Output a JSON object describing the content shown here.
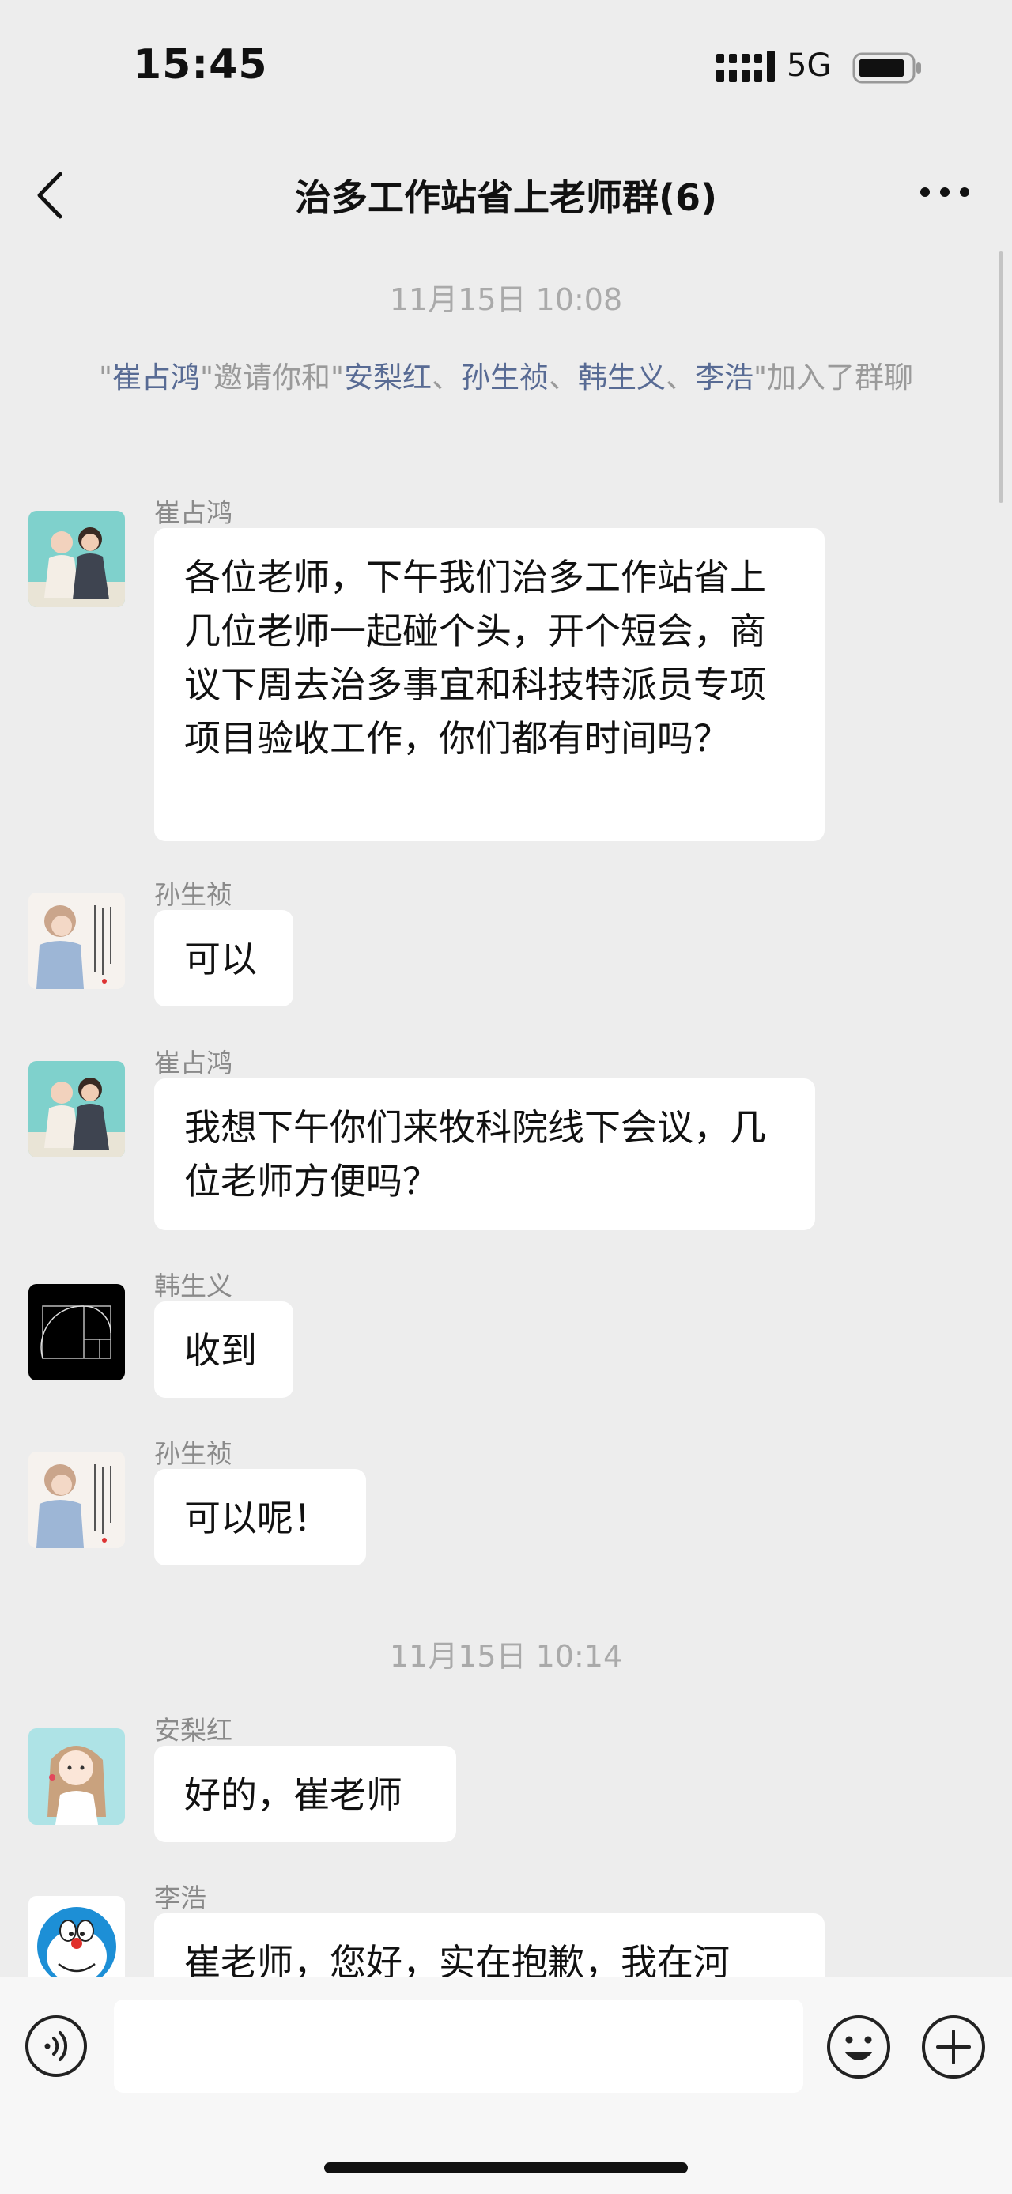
{
  "status_bar": {
    "time": "15:45",
    "network": "5G",
    "icons": [
      "signal-icon",
      "battery-icon"
    ]
  },
  "nav": {
    "title": "治多工作站省上老师群(6)",
    "icons": [
      "back-icon",
      "more-icon"
    ]
  },
  "timestamps": [
    "11月15日 10:08",
    "11月15日 10:14"
  ],
  "system_notice": {
    "q1": "\"",
    "inviter": "崔占鸿",
    "t1": "\"邀请你和\"",
    "n1": "安梨红",
    "sep1": "、",
    "n2": "孙生祯",
    "sep2": "、",
    "n3": "韩生义",
    "sep3": "、",
    "n4": "李浩",
    "t2": "\"加入了群聊"
  },
  "messages": [
    {
      "sender": "崔占鸿",
      "avatar": "two-girls-photo",
      "text": "各位老师，下午我们治多工作站省上几位老师一起碰个头，开个短会，商议下周去治多事宜和科技特派员专项项目验收工作，你们都有时间吗？"
    },
    {
      "sender": "孙生祯",
      "avatar": "illustrated-girl-with-text",
      "text": "可以"
    },
    {
      "sender": "崔占鸿",
      "avatar": "two-girls-photo",
      "text": "我想下午你们来牧科院线下会议，几位老师方便吗？"
    },
    {
      "sender": "韩生义",
      "avatar": "golden-spiral-black",
      "text": "收到"
    },
    {
      "sender": "孙生祯",
      "avatar": "illustrated-girl-with-text",
      "text": "可以呢！"
    },
    {
      "sender": "安梨红",
      "avatar": "cartoon-girl",
      "text": "好的，崔老师"
    },
    {
      "sender": "李浩",
      "avatar": "doraemon",
      "text": "崔老师，您好，实在抱歉，我在河"
    }
  ],
  "input_bar": {
    "icons": [
      "voice-icon",
      "emoji-icon",
      "plus-icon"
    ]
  },
  "colors": {
    "background": "#ededed",
    "bubble": "#ffffff",
    "link": "#586b94"
  }
}
